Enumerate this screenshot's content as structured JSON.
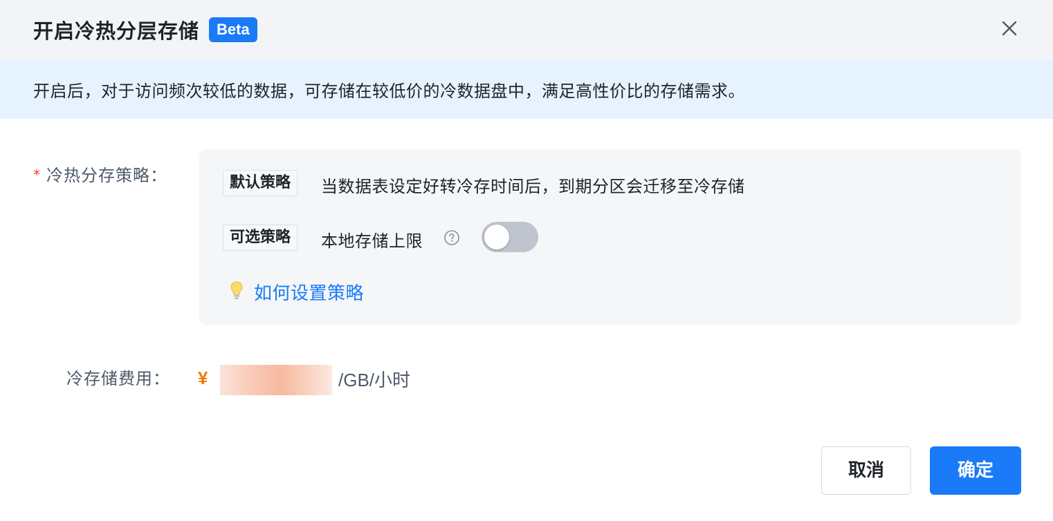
{
  "dialog": {
    "title": "开启冷热分层存储",
    "badge": "Beta",
    "close_icon": "close-icon"
  },
  "banner": {
    "text": "开启后，对于访问频次较低的数据，可存储在较低价的冷数据盘中，满足高性价比的存储需求。"
  },
  "strategy": {
    "label": "冷热分存策略：",
    "required": "*",
    "default_tag": "默认策略",
    "default_text": "当数据表设定好转冷存时间后，到期分区会迁移至冷存储",
    "optional_tag": "可选策略",
    "optional_text": "本地存储上限",
    "help_icon": "question-circle-icon",
    "toggle_on": false,
    "tip_icon": "lightbulb-icon",
    "tip_link": "如何设置策略"
  },
  "cost": {
    "label": "冷存储费用：",
    "currency": "¥",
    "unit": "/GB/小时"
  },
  "footer": {
    "cancel_label": "取消",
    "confirm_label": "确定"
  },
  "colors": {
    "primary": "#1a7af8",
    "banner_bg": "#e6f2fe",
    "required": "#f53f3f",
    "currency": "#f57a00",
    "toggle_off": "#bfc4cd"
  }
}
